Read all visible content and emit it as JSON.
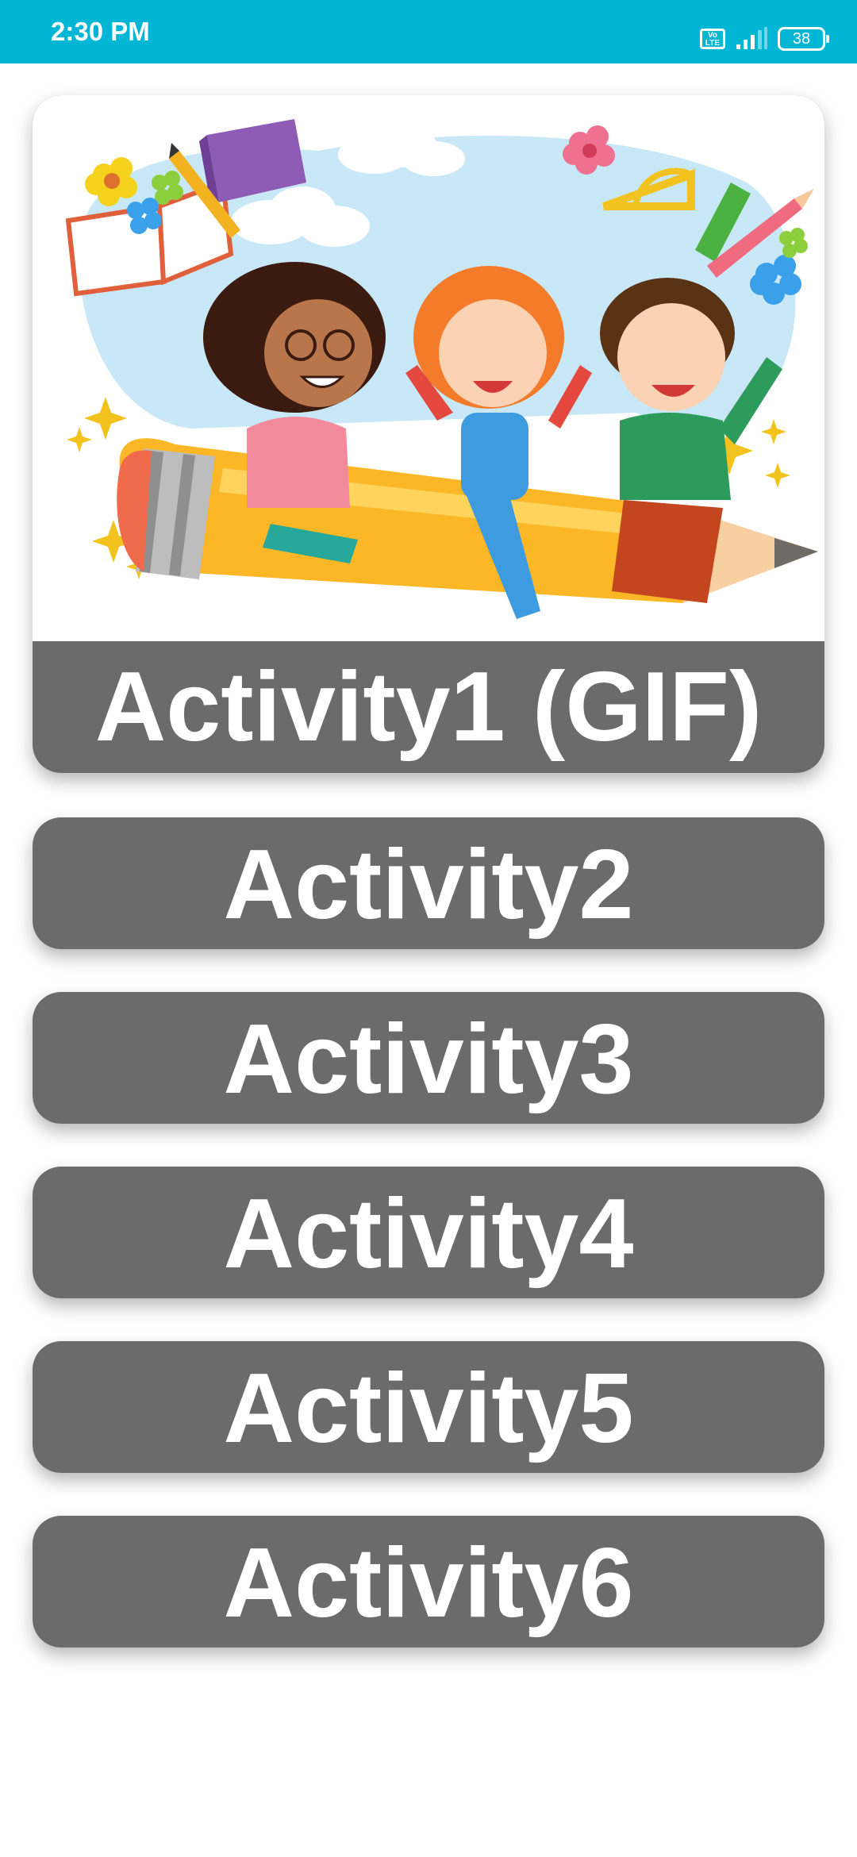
{
  "status_bar": {
    "time": "2:30 PM",
    "network_badge": "Vo LTE",
    "battery_level": "38",
    "icons": [
      "volte-icon",
      "signal-icon",
      "battery-icon"
    ]
  },
  "colors": {
    "status_bar": "#00b6d4",
    "button_background": "#6b6b6b",
    "button_text": "#ffffff",
    "page_background": "#ffffff"
  },
  "activities": [
    {
      "label": "Activity1 (GIF)",
      "image": "kids-riding-pencil-illustration"
    },
    {
      "label": "Activity2"
    },
    {
      "label": "Activity3"
    },
    {
      "label": "Activity4"
    },
    {
      "label": "Activity5"
    },
    {
      "label": "Activity6"
    }
  ]
}
